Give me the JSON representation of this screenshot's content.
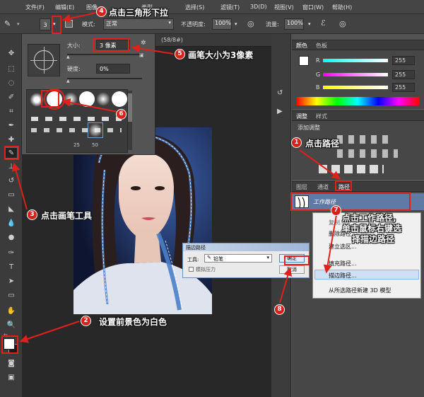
{
  "menubar": {
    "items": [
      "文件(F)",
      "编辑(E)",
      "图像",
      "类型",
      "选择(S)",
      "滤镜(T)",
      "3D(D)",
      "视图(V)",
      "窗口(W)",
      "帮助(H)"
    ]
  },
  "options_bar": {
    "brush_size": "3",
    "mode_label": "模式:",
    "mode_value": "正常",
    "opacity_label": "不透明度:",
    "opacity_value": "100%",
    "flow_label": "流量:",
    "flow_value": "100%"
  },
  "document": {
    "tab_suffix": "(58/8#)"
  },
  "brush_picker": {
    "size_label": "大小:",
    "size_value": "3 像素",
    "hardness_label": "硬度:",
    "hardness_value": "0%",
    "preset_sizes": [
      "25",
      "50"
    ]
  },
  "color_panel": {
    "tabs": [
      "颜色",
      "色板"
    ],
    "r_label": "R",
    "r_value": "255",
    "g_label": "G",
    "g_value": "255",
    "b_label": "B",
    "b_value": "255",
    "foreground": "#ffffff"
  },
  "adjust_panel": {
    "tabs": [
      "调整",
      "样式"
    ],
    "title": "添加调整"
  },
  "paths_panel": {
    "tabs": [
      "图层",
      "通道",
      "路径"
    ],
    "work_path": "工作路径"
  },
  "context_menu": {
    "items": [
      "复制...",
      "删除路径",
      "建立选区...",
      "填充路径...",
      "描边路径...",
      "从所选路径新建 3D 模型"
    ]
  },
  "stroke_dialog": {
    "title": "描边路径",
    "tool_label": "工具:",
    "tool_value": "铅笔",
    "simulate_pressure": "模拟压力",
    "ok": "确定",
    "cancel": "取消"
  },
  "annotations": {
    "n1": "1",
    "t1": "点击路径",
    "n2": "2",
    "t2": "设置前景色为白色",
    "n3": "3",
    "t3": "点击画笔工具",
    "n4": "4",
    "t4": "点击三角形下拉",
    "n5": "5",
    "t5": "画笔大小为3像素",
    "n6": "6",
    "n7": "7",
    "t7a": "点击工作路径,",
    "t7b": "单击鼠标右键选",
    "t7c": "择描边路径",
    "n8": "8"
  },
  "colors": {
    "annotation_red": "#e0201b",
    "selection_blue": "#4a7fc9",
    "panel_bg": "#474747"
  }
}
